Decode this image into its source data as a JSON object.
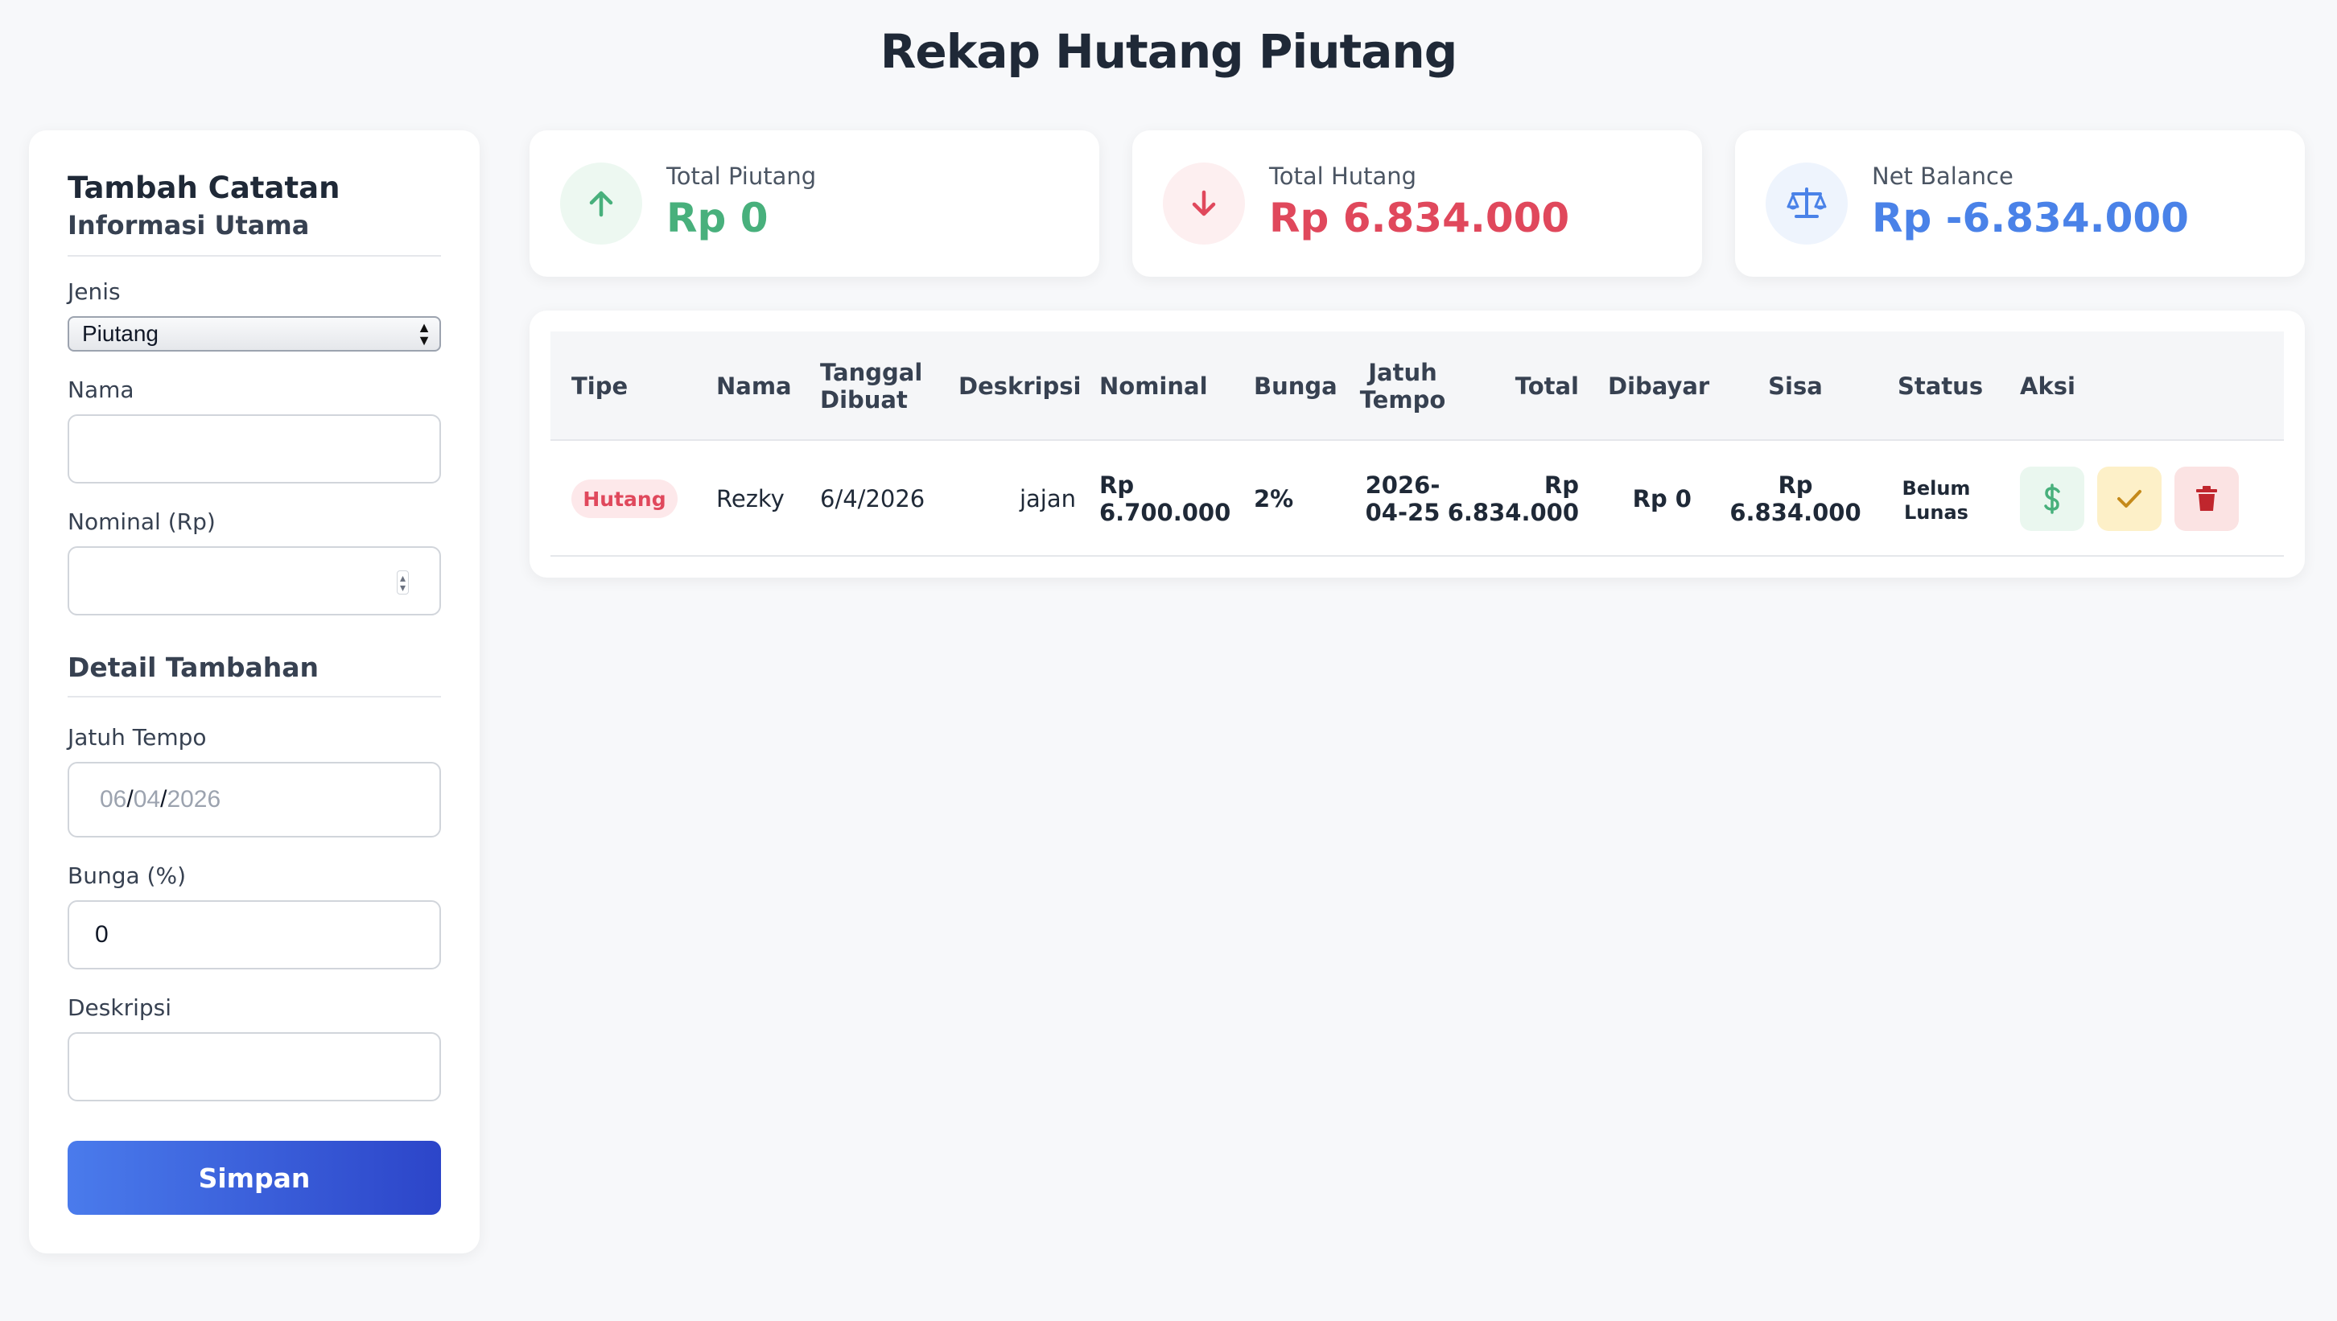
{
  "page_title": "Rekap Hutang Piutang",
  "form": {
    "title": "Tambah Catatan",
    "subtitle": "Informasi Utama",
    "jenis_label": "Jenis",
    "jenis_value": "Piutang",
    "nama_label": "Nama",
    "nama_value": "",
    "nominal_label": "Nominal (Rp)",
    "nominal_value": "",
    "detail_title": "Detail Tambahan",
    "jatuh_tempo_label": "Jatuh Tempo",
    "jatuh_tempo_day": "06",
    "jatuh_tempo_month": "04",
    "jatuh_tempo_year": "2026",
    "date_separator": "/",
    "bunga_label": "Bunga (%)",
    "bunga_value": "0",
    "deskripsi_label": "Deskripsi",
    "deskripsi_value": "",
    "save_label": "Simpan"
  },
  "summary": {
    "piutang": {
      "label": "Total Piutang",
      "value": "Rp 0",
      "color": "#48b07c",
      "icon": "arrow-up-icon"
    },
    "hutang": {
      "label": "Total Hutang",
      "value": "Rp 6.834.000",
      "color": "#e0485c",
      "icon": "arrow-down-icon"
    },
    "net": {
      "label": "Net Balance",
      "value": "Rp -6.834.000",
      "color": "#4a82e8",
      "icon": "scale-icon"
    }
  },
  "table": {
    "headers": {
      "tipe": "Tipe",
      "nama": "Nama",
      "tanggal_1": "Tanggal",
      "tanggal_2": "Dibuat",
      "deskripsi": "Deskripsi",
      "nominal": "Nominal",
      "bunga": "Bunga",
      "jatuh_1": "Jatuh",
      "jatuh_2": "Tempo",
      "total": "Total",
      "dibayar": "Dibayar",
      "sisa": "Sisa",
      "status": "Status",
      "aksi": "Aksi"
    },
    "rows": [
      {
        "tipe": "Hutang",
        "nama": "Rezky",
        "tanggal": "6/4/2026",
        "deskripsi": "jajan",
        "nominal_1": "Rp",
        "nominal_2": "6.700.000",
        "bunga": "2%",
        "jatuh_1": "2026-",
        "jatuh_2": "04-25",
        "total_1": "Rp",
        "total_2": "6.834.000",
        "dibayar": "Rp 0",
        "sisa_1": "Rp",
        "sisa_2": "6.834.000",
        "status_1": "Belum",
        "status_2": "Lunas",
        "actions": [
          "dollar-icon",
          "check-icon",
          "trash-icon"
        ]
      }
    ]
  },
  "colors": {
    "accent": "#3b5bdb",
    "positive": "#48b07c",
    "negative": "#e0485c",
    "balance": "#4a82e8"
  }
}
